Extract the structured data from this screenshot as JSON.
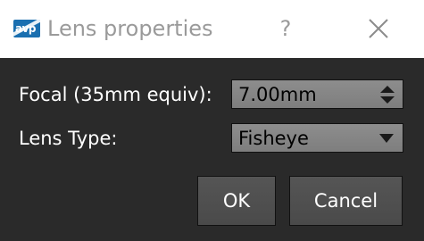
{
  "window": {
    "title": "Lens properties",
    "app_icon_text": "avp",
    "help_label": "?",
    "close_icon": "close-icon"
  },
  "form": {
    "focal_label": "Focal (35mm equiv):",
    "focal_value": "7.00mm",
    "lens_type_label": "Lens Type:",
    "lens_type_value": "Fisheye"
  },
  "buttons": {
    "ok_label": "OK",
    "cancel_label": "Cancel"
  },
  "colors": {
    "titlebar": "#ffffff",
    "dialog_bg": "#2a2a2a",
    "field_bg": "#858585",
    "button_bg": "#505050",
    "brand": "#1a6fb0"
  }
}
